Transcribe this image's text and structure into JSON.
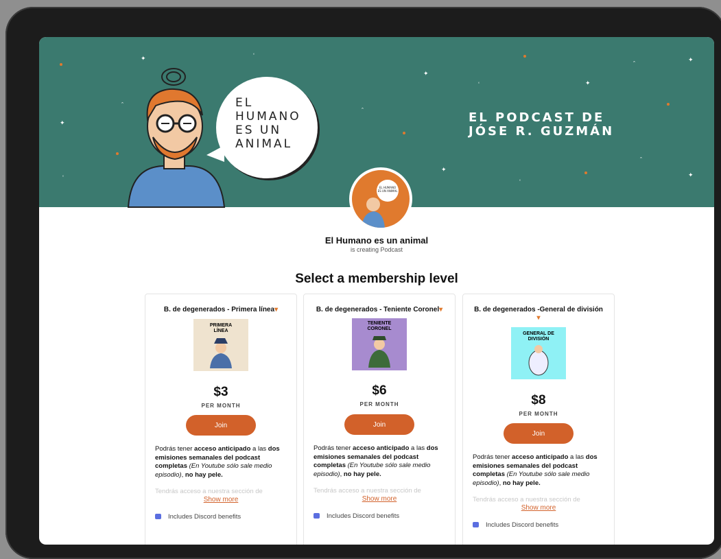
{
  "banner": {
    "speech_bubble": [
      "EL",
      "HUMANO",
      "ES UN",
      "ANIMAL"
    ],
    "title_lines": [
      "EL PODCAST DE",
      "JÓSE R. GUZMÁN"
    ],
    "bg_color": "#3b7a6f"
  },
  "creator": {
    "name": "El Humano es un animal",
    "subtitle": "is creating Podcast",
    "avatar_text": "EL HUMANO ES UN ANIMAL"
  },
  "section_title": "Select a membership level",
  "tiers": [
    {
      "title": "B. de degenerados - Primera línea",
      "image_label": "PRIMERA LÍNEA",
      "image_bg": "#efe3cf",
      "price": "$3",
      "period": "PER MONTH",
      "join_label": "Join",
      "desc_plain_1": "Podrás tener ",
      "desc_bold_1": "acceso anticipado",
      "desc_plain_2": " a las ",
      "desc_bold_2": "dos emisiones semanales del podcast completas",
      "desc_italic": " (En Youtube sólo sale medio episodio)",
      "desc_plain_3": ", ",
      "desc_bold_3": "no hay pele.",
      "faded_text": "Tendrás acceso a nuestra sección de",
      "show_more": "Show more",
      "discord": "Includes Discord benefits"
    },
    {
      "title": "B. de degenerados - Teniente Coronel",
      "image_label": "TENIENTE CORONEL",
      "image_bg": "#a78bcf",
      "price": "$6",
      "period": "PER MONTH",
      "join_label": "Join",
      "desc_plain_1": "Podrás tener ",
      "desc_bold_1": "acceso anticipado",
      "desc_plain_2": " a las ",
      "desc_bold_2": "dos emisiones semanales del podcast completas",
      "desc_italic": " (En Youtube sólo sale medio episodio)",
      "desc_plain_3": ", ",
      "desc_bold_3": "no hay pele.",
      "faded_text": "Tendrás acceso a nuestra sección de",
      "show_more": "Show more",
      "discord": "Includes Discord benefits"
    },
    {
      "title": "B. de degenerados -General de división",
      "image_label": "GENERAL DE DIVISIÓN",
      "image_bg": "#8ff1f5",
      "price": "$8",
      "period": "PER MONTH",
      "join_label": "Join",
      "desc_plain_1": "Podrás tener ",
      "desc_bold_1": "acceso anticipado",
      "desc_plain_2": " a las ",
      "desc_bold_2": "dos emisiones semanales del podcast completas",
      "desc_italic": " (En Youtube sólo sale medio episodio)",
      "desc_plain_3": ", ",
      "desc_bold_3": "no hay pele.",
      "faded_text": "Tendrás acceso a nuestra sección de",
      "show_more": "Show more",
      "discord": "Includes Discord benefits"
    }
  ],
  "colors": {
    "accent": "#d2612a",
    "discord": "#5b6ee0"
  }
}
